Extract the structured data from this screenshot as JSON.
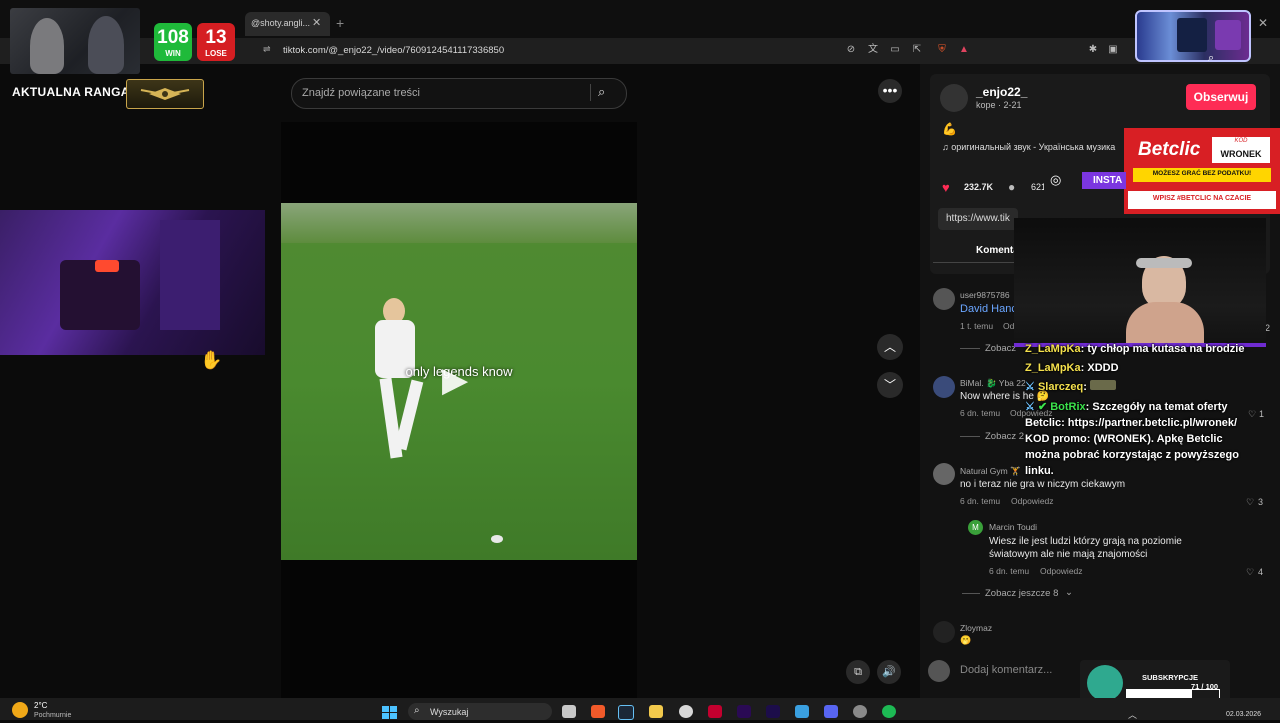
{
  "browser": {
    "tab_title": "@shoty.angli...",
    "tab_close": "✕",
    "new_tab": "+",
    "url": "tiktok.com/@_enjo22_/video/7609124541117336850",
    "window_close": "✕"
  },
  "stream_overlay": {
    "wins": "108",
    "wins_label": "WIN",
    "losses": "13",
    "losses_label": "LOSE",
    "rank_label": "AKTUALNA RANGA:",
    "instagram_label": "INSTA"
  },
  "search": {
    "placeholder": "Znajdź powiązane treści"
  },
  "video": {
    "caption": "only legends know"
  },
  "author": {
    "name": "_enjo22_",
    "subtitle": "kope · 2-21",
    "follow_label": "Obserwuj",
    "music": "оригинальный звук - Українська музика",
    "likes": "232.7K",
    "comments_count": "621",
    "link_partial": "https://www.tik",
    "comments_tab": "Komenta"
  },
  "comments": [
    {
      "user": "user9875786",
      "text": "David Hanc",
      "meta": "1 t. temu",
      "reply": "Od",
      "likes": "2",
      "more": "Zobacz"
    },
    {
      "user": "BiMal. 🐉 Yba 22",
      "text": "Now where is he 🤔",
      "meta": "6 dn. temu",
      "reply": "Odpowiedz",
      "likes": "1",
      "more": "Zobacz 2"
    },
    {
      "user": "Natural Gym 🏋",
      "text": "no i teraz nie gra w niczym ciekawym",
      "meta": "6 dn. temu",
      "reply": "Odpowiedz",
      "likes": "3"
    },
    {
      "user": "Marcin Toudi",
      "text": "Wiesz ile jest ludzi którzy grają na poziomie światowym ale nie mają znajomości",
      "meta": "6 dn. temu",
      "reply": "Odpowiedz",
      "likes": "4",
      "more": "Zobacz jeszcze 8"
    },
    {
      "user": "Zloymaz",
      "text": "🫢"
    }
  ],
  "comment_input": {
    "placeholder": "Dodaj komentarz..."
  },
  "chat": [
    {
      "user": "Z_LaMpKa",
      "text": "ty chłop ma kutasa na brodzie"
    },
    {
      "user": "Z_LaMpKa",
      "text": "XDDD"
    },
    {
      "user": "Slarczeq",
      "text": ""
    },
    {
      "user": "BotRix",
      "text": "Szczegóły na temat oferty Betclic: https://partner.betclic.pl/wronek/ KOD promo: (WRONEK). Apkę Betclic można pobrać korzystając z powyższego linku."
    }
  ],
  "betclic": {
    "logo": "Betclic",
    "kod_label": "KOD",
    "code": "WRONEK",
    "tagline": "MOŻESZ GRAĆ BEZ PODATKU!",
    "bottom": "WPISZ #BETCLIC NA CZACIE"
  },
  "subs": {
    "label": "SUBSKRYPCJE",
    "count": "71 / 100",
    "progress": 0.71
  },
  "taskbar": {
    "weather_temp": "2°C",
    "weather_desc": "Pochmurnie",
    "search_label": "Wyszukaj",
    "date": "02.03.2026"
  },
  "colors": {
    "follow": "#fe2c55",
    "win": "#1fba3a",
    "lose": "#d51e22",
    "betclic": "#d81f24",
    "chat_user": "#f4e04d"
  }
}
